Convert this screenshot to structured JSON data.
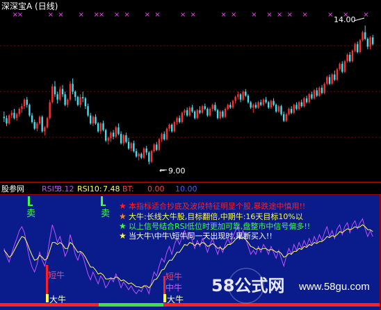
{
  "main_panel": {
    "title": "深深宝A (日线)",
    "high_label": "14.00",
    "low_label": "9.00",
    "colors": {
      "background": "#000000",
      "rising": "#ff3030",
      "falling": "#40e0f0",
      "marker": "#ff40ff",
      "grid": "#8b0000",
      "text": "#ffffff"
    }
  },
  "indicator_panel": {
    "name": "股参网",
    "rsi5_label": "RSI5:",
    "rsi5_value": "8.12",
    "rsi10_label": "RSI10:",
    "rsi10_value": "7.48",
    "bt_label": "BT:",
    "bt_value": "0.00",
    "extra_value": "10.00",
    "notes": [
      {
        "star": "★",
        "text": "本指标适合抄底及波段特征明显个股,暴跌途中慎用!!",
        "color": "#ff2020"
      },
      {
        "star": "★",
        "text": "大牛:长线大牛股,目标翻倍,中期牛:16天目标10%以",
        "color": "#ffff40"
      },
      {
        "star": "★",
        "text": "以上信号结合RSI低位时更加可靠,盘整市中信号偏多!!",
        "color": "#40ff40"
      },
      {
        "star": "★",
        "text": "当大牛\\中牛\\短牛同一天出现时,果断买入!!",
        "color": "#ffffff"
      }
    ],
    "signal_labels": {
      "sell_1": "卖",
      "sell_2": "卖",
      "short_bull_1": "短牛",
      "short_bull_2": "短牛",
      "mid_bull": "中牛",
      "big_bull_1": "大牛",
      "big_bull_2": "大牛"
    },
    "colors": {
      "background": "#0a1c8c",
      "rsi5": "#c050ff",
      "rsi10": "#ffff60"
    }
  },
  "watermark": {
    "logo_text": "58公式网",
    "url": "www.58gu.com"
  },
  "chart_data": [
    {
      "type": "candlestick",
      "title": "深深宝A (日线)",
      "x_unit": "trading day index",
      "annotations": [
        {
          "label": "14.00",
          "x": 145,
          "y": 14.0
        },
        {
          "label": "9.00",
          "x": 57,
          "y": 9.0
        }
      ],
      "ylim": [
        8.2,
        14.6
      ],
      "ohlc": [
        [
          10.55,
          10.75,
          10.35,
          10.5
        ],
        [
          10.5,
          10.6,
          10.2,
          10.3
        ],
        [
          10.3,
          10.65,
          10.25,
          10.6
        ],
        [
          10.6,
          10.8,
          10.5,
          10.7
        ],
        [
          10.7,
          10.85,
          10.45,
          10.5
        ],
        [
          10.5,
          10.7,
          10.4,
          10.65
        ],
        [
          10.65,
          10.9,
          10.55,
          10.85
        ],
        [
          10.85,
          11.05,
          10.7,
          10.95
        ],
        [
          10.95,
          11.25,
          10.85,
          11.2
        ],
        [
          11.2,
          11.3,
          10.9,
          11.0
        ],
        [
          11.0,
          11.05,
          10.55,
          10.6
        ],
        [
          10.6,
          10.7,
          10.3,
          10.35
        ],
        [
          10.35,
          10.45,
          10.05,
          10.1
        ],
        [
          10.1,
          10.35,
          10.0,
          10.3
        ],
        [
          10.3,
          10.6,
          10.25,
          10.55
        ],
        [
          10.55,
          10.6,
          9.95,
          10.0
        ],
        [
          10.0,
          10.2,
          9.85,
          10.15
        ],
        [
          10.15,
          10.55,
          10.1,
          10.5
        ],
        [
          10.5,
          11.2,
          10.45,
          11.1
        ],
        [
          11.1,
          11.8,
          11.05,
          11.7
        ],
        [
          11.7,
          11.9,
          11.3,
          11.4
        ],
        [
          11.4,
          11.5,
          11.05,
          11.2
        ],
        [
          11.2,
          11.7,
          11.15,
          11.6
        ],
        [
          11.6,
          11.75,
          11.3,
          11.4
        ],
        [
          11.4,
          11.5,
          10.95,
          11.0
        ],
        [
          11.0,
          11.25,
          10.9,
          11.2
        ],
        [
          11.2,
          11.9,
          11.15,
          11.8
        ],
        [
          11.8,
          12.0,
          11.4,
          11.5
        ],
        [
          11.5,
          11.55,
          11.15,
          11.3
        ],
        [
          11.3,
          11.35,
          10.95,
          11.0
        ],
        [
          11.0,
          11.4,
          10.9,
          11.3
        ],
        [
          11.3,
          11.5,
          11.1,
          11.25
        ],
        [
          11.25,
          11.3,
          10.85,
          10.95
        ],
        [
          10.95,
          11.05,
          10.55,
          10.6
        ],
        [
          10.6,
          10.7,
          10.25,
          10.3
        ],
        [
          10.3,
          10.6,
          10.2,
          10.55
        ],
        [
          10.55,
          10.65,
          10.25,
          10.3
        ],
        [
          10.3,
          10.35,
          9.95,
          10.0
        ],
        [
          10.0,
          10.35,
          9.9,
          10.3
        ],
        [
          10.3,
          10.4,
          10.0,
          10.05
        ],
        [
          10.05,
          10.1,
          9.6,
          9.65
        ],
        [
          9.65,
          9.8,
          9.5,
          9.75
        ],
        [
          9.75,
          10.0,
          9.6,
          9.95
        ],
        [
          9.95,
          10.05,
          9.7,
          9.8
        ],
        [
          9.8,
          10.2,
          9.75,
          10.15
        ],
        [
          10.15,
          10.3,
          9.85,
          9.9
        ],
        [
          9.9,
          10.0,
          9.5,
          9.55
        ],
        [
          9.55,
          9.9,
          9.45,
          9.85
        ],
        [
          9.85,
          9.95,
          9.55,
          9.6
        ],
        [
          9.6,
          9.75,
          9.3,
          9.35
        ],
        [
          9.35,
          9.6,
          9.25,
          9.55
        ],
        [
          9.55,
          9.65,
          9.2,
          9.25
        ],
        [
          9.25,
          9.35,
          9.0,
          9.05
        ],
        [
          9.05,
          9.2,
          8.9,
          9.15
        ],
        [
          9.15,
          9.2,
          8.95,
          9.0
        ],
        [
          9.0,
          9.4,
          8.95,
          9.35
        ],
        [
          9.35,
          9.45,
          9.1,
          9.2
        ],
        [
          9.2,
          9.25,
          8.75,
          8.85
        ],
        [
          8.85,
          9.3,
          8.8,
          9.25
        ],
        [
          9.25,
          9.55,
          9.2,
          9.5
        ],
        [
          9.5,
          9.6,
          9.25,
          9.3
        ],
        [
          9.3,
          9.75,
          9.25,
          9.7
        ],
        [
          9.7,
          9.95,
          9.6,
          9.9
        ],
        [
          9.9,
          10.0,
          9.65,
          9.7
        ],
        [
          9.7,
          10.15,
          9.65,
          10.1
        ],
        [
          10.1,
          10.3,
          10.0,
          10.25
        ],
        [
          10.25,
          10.3,
          9.95,
          10.0
        ],
        [
          10.0,
          10.4,
          9.95,
          10.35
        ],
        [
          10.35,
          10.55,
          10.25,
          10.5
        ],
        [
          10.5,
          10.6,
          10.3,
          10.35
        ],
        [
          10.35,
          10.75,
          10.3,
          10.7
        ],
        [
          10.7,
          10.85,
          10.6,
          10.8
        ],
        [
          10.8,
          10.9,
          10.55,
          10.6
        ],
        [
          10.6,
          10.95,
          10.55,
          10.9
        ],
        [
          10.9,
          11.0,
          10.7,
          10.75
        ],
        [
          10.75,
          10.8,
          10.45,
          10.5
        ],
        [
          10.5,
          10.85,
          10.45,
          10.8
        ],
        [
          10.8,
          10.95,
          10.65,
          10.7
        ],
        [
          10.7,
          11.0,
          10.65,
          10.95
        ],
        [
          10.95,
          11.05,
          10.8,
          10.85
        ],
        [
          10.85,
          10.9,
          10.55,
          10.6
        ],
        [
          10.6,
          10.9,
          10.55,
          10.85
        ],
        [
          10.85,
          11.05,
          10.75,
          11.0
        ],
        [
          11.0,
          11.1,
          10.75,
          10.8
        ],
        [
          10.8,
          10.85,
          10.45,
          10.5
        ],
        [
          10.5,
          10.8,
          10.45,
          10.75
        ],
        [
          10.75,
          10.8,
          10.5,
          10.55
        ],
        [
          10.55,
          10.9,
          10.5,
          10.85
        ],
        [
          10.85,
          11.05,
          10.8,
          11.0
        ],
        [
          11.0,
          11.1,
          10.85,
          10.9
        ],
        [
          10.9,
          11.2,
          10.85,
          11.15
        ],
        [
          11.15,
          11.35,
          11.05,
          11.3
        ],
        [
          11.3,
          11.5,
          11.2,
          11.4
        ],
        [
          11.4,
          11.45,
          11.1,
          11.2
        ],
        [
          11.2,
          11.55,
          11.15,
          11.5
        ],
        [
          11.5,
          11.6,
          11.3,
          11.35
        ],
        [
          11.35,
          11.4,
          11.05,
          11.1
        ],
        [
          11.1,
          11.15,
          10.85,
          10.9
        ],
        [
          10.9,
          11.05,
          10.7,
          11.0
        ],
        [
          11.0,
          11.1,
          10.85,
          10.9
        ],
        [
          10.9,
          11.15,
          10.85,
          11.1
        ],
        [
          11.1,
          11.2,
          10.95,
          11.0
        ],
        [
          11.0,
          11.25,
          10.95,
          11.2
        ],
        [
          11.2,
          11.3,
          11.05,
          11.1
        ],
        [
          11.1,
          11.15,
          10.85,
          10.9
        ],
        [
          10.9,
          11.2,
          10.85,
          11.15
        ],
        [
          11.15,
          11.25,
          10.95,
          11.0
        ],
        [
          11.0,
          11.05,
          10.7,
          10.75
        ],
        [
          10.75,
          11.0,
          10.7,
          10.95
        ],
        [
          10.95,
          11.0,
          10.6,
          10.65
        ],
        [
          10.65,
          10.75,
          10.35,
          10.4
        ],
        [
          10.4,
          10.7,
          10.35,
          10.65
        ],
        [
          10.65,
          10.9,
          10.6,
          10.85
        ],
        [
          10.85,
          10.95,
          10.65,
          10.7
        ],
        [
          10.7,
          11.05,
          10.65,
          11.0
        ],
        [
          11.0,
          11.1,
          10.8,
          10.85
        ],
        [
          10.85,
          11.15,
          10.8,
          11.1
        ],
        [
          11.1,
          11.2,
          10.9,
          10.95
        ],
        [
          10.95,
          11.3,
          10.9,
          11.25
        ],
        [
          11.25,
          11.35,
          11.05,
          11.1
        ],
        [
          11.1,
          11.45,
          11.05,
          11.4
        ],
        [
          11.4,
          11.5,
          11.2,
          11.25
        ],
        [
          11.25,
          11.6,
          11.2,
          11.55
        ],
        [
          11.55,
          11.65,
          11.3,
          11.35
        ],
        [
          11.35,
          11.7,
          11.3,
          11.65
        ],
        [
          11.65,
          11.75,
          11.4,
          11.45
        ],
        [
          11.45,
          11.85,
          11.4,
          11.8
        ],
        [
          11.8,
          12.1,
          11.75,
          12.05
        ],
        [
          12.05,
          12.15,
          11.75,
          11.8
        ],
        [
          11.8,
          12.2,
          11.75,
          12.15
        ],
        [
          12.15,
          12.3,
          11.9,
          11.95
        ],
        [
          11.95,
          12.4,
          11.9,
          12.35
        ],
        [
          12.35,
          12.6,
          12.3,
          12.55
        ],
        [
          12.55,
          12.65,
          12.2,
          12.25
        ],
        [
          12.25,
          12.7,
          12.2,
          12.65
        ],
        [
          12.65,
          12.95,
          12.6,
          12.9
        ],
        [
          12.9,
          13.0,
          12.6,
          12.65
        ],
        [
          12.65,
          13.1,
          12.6,
          13.05
        ],
        [
          13.05,
          13.35,
          13.0,
          13.3
        ],
        [
          13.3,
          13.4,
          12.95,
          13.0
        ],
        [
          13.0,
          13.5,
          12.95,
          13.45
        ],
        [
          13.45,
          13.8,
          13.4,
          13.75
        ],
        [
          13.75,
          14.0,
          13.45,
          13.5
        ],
        [
          13.5,
          13.55,
          13.1,
          13.2
        ],
        [
          13.2,
          13.6,
          13.1,
          13.55
        ],
        [
          13.55,
          13.65,
          13.25,
          13.3
        ]
      ],
      "marker_days": [
        4,
        6,
        18,
        22,
        30,
        36,
        38,
        44,
        48,
        56,
        60,
        70,
        74,
        86,
        90,
        98,
        104,
        108,
        112,
        118,
        128,
        134,
        142
      ]
    },
    {
      "type": "line",
      "title": "",
      "x_unit": "trading day index",
      "ylim": [
        0,
        100
      ],
      "series": [
        {
          "name": "RSI5",
          "color": "#c050ff",
          "values": [
            52,
            44,
            38,
            47,
            55,
            62,
            70,
            74,
            68,
            55,
            42,
            33,
            28,
            36,
            48,
            40,
            34,
            45,
            62,
            76,
            68,
            58,
            64,
            55,
            44,
            50,
            66,
            57,
            46,
            40,
            48,
            44,
            35,
            26,
            20,
            28,
            22,
            16,
            24,
            20,
            12,
            16,
            22,
            18,
            26,
            20,
            12,
            18,
            14,
            10,
            14,
            9,
            6,
            10,
            8,
            14,
            12,
            6,
            18,
            28,
            24,
            34,
            42,
            38,
            48,
            54,
            46,
            56,
            62,
            56,
            64,
            70,
            62,
            68,
            60,
            52,
            60,
            54,
            62,
            56,
            48,
            56,
            62,
            54,
            46,
            54,
            48,
            56,
            62,
            56,
            64,
            70,
            74,
            64,
            70,
            62,
            54,
            46,
            50,
            46,
            54,
            48,
            56,
            52,
            46,
            54,
            48,
            42,
            50,
            42,
            34,
            44,
            52,
            46,
            56,
            50,
            58,
            52,
            60,
            54,
            62,
            56,
            64,
            58,
            66,
            60,
            68,
            74,
            64,
            70,
            62,
            72,
            76,
            66,
            74,
            78,
            68,
            76,
            80,
            72,
            78,
            82,
            72,
            64,
            70,
            64
          ]
        },
        {
          "name": "RSI10",
          "color": "#ffff60",
          "values": [
            50,
            47,
            43,
            45,
            50,
            55,
            60,
            64,
            63,
            58,
            51,
            45,
            40,
            41,
            45,
            43,
            40,
            42,
            50,
            58,
            58,
            56,
            58,
            56,
            52,
            52,
            58,
            56,
            52,
            48,
            49,
            47,
            43,
            38,
            33,
            33,
            30,
            26,
            27,
            25,
            21,
            21,
            22,
            21,
            23,
            22,
            19,
            20,
            18,
            16,
            17,
            15,
            13,
            13,
            12,
            14,
            14,
            12,
            15,
            20,
            21,
            25,
            30,
            31,
            36,
            40,
            40,
            44,
            48,
            48,
            52,
            56,
            55,
            58,
            57,
            55,
            57,
            56,
            58,
            57,
            54,
            55,
            57,
            55,
            52,
            53,
            51,
            53,
            56,
            56,
            58,
            61,
            64,
            62,
            63,
            61,
            58,
            54,
            53,
            51,
            52,
            51,
            52,
            52,
            50,
            51,
            50,
            48,
            49,
            47,
            43,
            44,
            47,
            46,
            49,
            49,
            52,
            51,
            54,
            53,
            56,
            55,
            58,
            57,
            59,
            59,
            61,
            64,
            63,
            65,
            64,
            66,
            69,
            68,
            70,
            72,
            71,
            72,
            74,
            73,
            74,
            76,
            74,
            71,
            71,
            69
          ]
        }
      ]
    }
  ]
}
